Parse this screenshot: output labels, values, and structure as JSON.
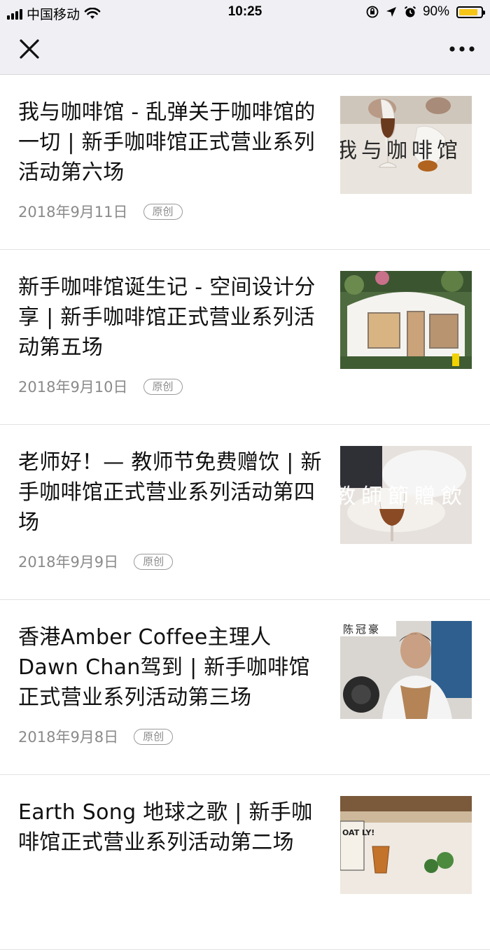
{
  "status_bar": {
    "carrier": "中国移动",
    "time": "10:25",
    "battery": "90%",
    "battery_level": 0.9
  },
  "nav": {
    "close_icon": "close-icon",
    "more_icon": "more-icon"
  },
  "articles": [
    {
      "title": "我与咖啡馆 - 乱弹关于咖啡馆的一切 | 新手咖啡馆正式营业系列活动第六场",
      "date": "2018年9月11日",
      "badge": "原创",
      "thumb_text": "我与咖啡馆"
    },
    {
      "title": "新手咖啡馆诞生记 - 空间设计分享 | 新手咖啡馆正式营业系列活动第五场",
      "date": "2018年9月10日",
      "badge": "原创"
    },
    {
      "title": "老师好！— 教师节免费赠饮 | 新手咖啡馆正式营业系列活动第四场",
      "date": "2018年9月9日",
      "badge": "原创",
      "thumb_text": "教師節贈飲"
    },
    {
      "title": "香港Amber Coffee主理人Dawn Chan驾到 | 新手咖啡馆正式营业系列活动第三场",
      "date": "2018年9月8日",
      "badge": "原创",
      "thumb_text": "陈冠豪"
    },
    {
      "title": "Earth Song 地球之歌 | 新手咖啡馆正式营业系列活动第二场",
      "date": "",
      "badge": "",
      "thumb_text": "OAT LY!"
    }
  ]
}
